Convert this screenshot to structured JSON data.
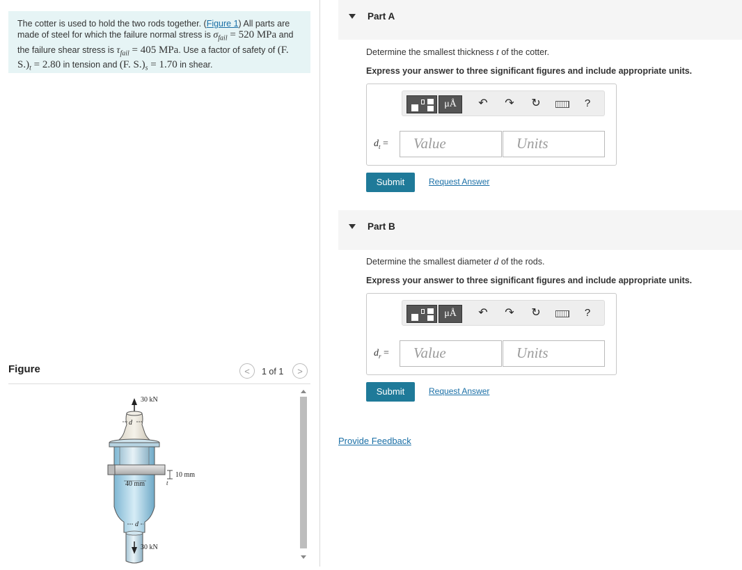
{
  "problem": {
    "text_1": "The cotter is used to hold the two rods together. (",
    "figure_link": "Figure 1",
    "text_2": ") All parts are made of steel for which the failure normal stress is ",
    "sigma_fail": "σ",
    "sigma_sub": "fail",
    "sigma_value": " = 520 MPa",
    "text_3": " and the failure shear stress is ",
    "tau_fail": "τ",
    "tau_sub": "fail",
    "tau_value": " = 405 MPa",
    "text_4": ". Use a factor of safety of ",
    "fs_t": "(F. S.)",
    "fs_t_sub": "t",
    "fs_t_value": " = 2.80",
    "text_5": " in tension and ",
    "fs_s": "(F. S.)",
    "fs_s_sub": "s",
    "fs_s_value": " = 1.70",
    "text_6": " in shear."
  },
  "figure": {
    "title": "Figure",
    "pager": "1 of 1",
    "prev": "<",
    "next": ">",
    "labels": {
      "top_load": "30 kN",
      "bottom_load": "30 kN",
      "d_top": "d",
      "d_bottom": "d",
      "width": "40 mm",
      "thickness": "10 mm",
      "t": "t"
    }
  },
  "partA": {
    "title": "Part A",
    "prompt_1": "Determine the smallest thickness ",
    "prompt_var": "t",
    "prompt_2": " of the cotter.",
    "instruction": "Express your answer to three significant figures and include appropriate units.",
    "var": "d",
    "var_sub": "t",
    "eq": " =",
    "value_placeholder": "Value",
    "units_placeholder": "Units",
    "submit": "Submit",
    "request": "Request Answer"
  },
  "partB": {
    "title": "Part B",
    "prompt_1": "Determine the smallest diameter ",
    "prompt_var": "d",
    "prompt_2": " of the rods.",
    "instruction": "Express your answer to three significant figures and include appropriate units.",
    "var": "d",
    "var_sub": "r",
    "eq": " =",
    "value_placeholder": "Value",
    "units_placeholder": "Units",
    "submit": "Submit",
    "request": "Request Answer"
  },
  "toolbar": {
    "mu": "μÅ",
    "undo": "↶",
    "redo": "↷",
    "reset": "↻",
    "help": "?",
    "icons": [
      "templates-icon",
      "units-icon",
      "undo-icon",
      "redo-icon",
      "reset-icon",
      "keyboard-icon",
      "help-icon"
    ]
  },
  "feedback": "Provide Feedback"
}
